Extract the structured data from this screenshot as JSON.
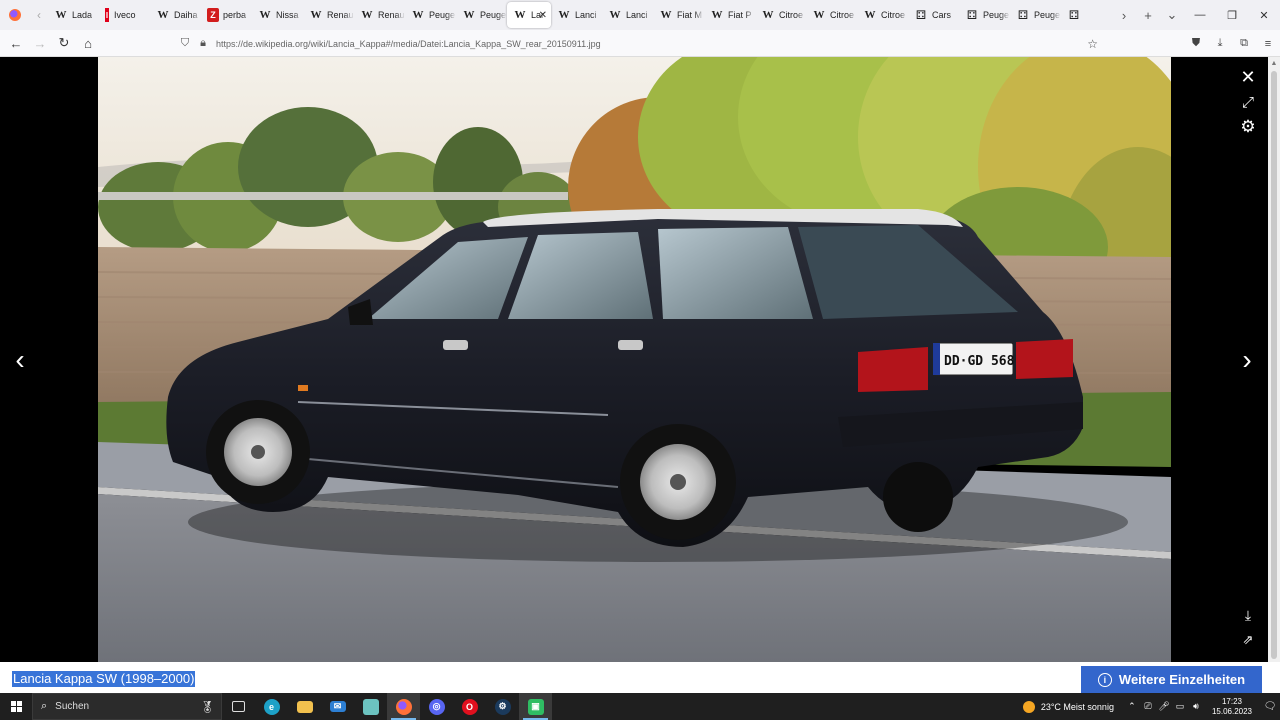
{
  "browser": {
    "tabs": [
      {
        "icon": "W",
        "label": "Lada",
        "favicon": "wikipedia-icon"
      },
      {
        "icon": "I",
        "label": "Iveco",
        "favicon": "iveco-icon"
      },
      {
        "icon": "W",
        "label": "Daiha",
        "favicon": "wikipedia-icon"
      },
      {
        "icon": "Z",
        "label": "perba",
        "favicon": "pdf-icon"
      },
      {
        "icon": "W",
        "label": "Nissa",
        "favicon": "wikipedia-icon"
      },
      {
        "icon": "W",
        "label": "Renau",
        "favicon": "wikipedia-icon"
      },
      {
        "icon": "W",
        "label": "Renau",
        "favicon": "wikipedia-icon"
      },
      {
        "icon": "W",
        "label": "Peuge",
        "favicon": "wikipedia-icon"
      },
      {
        "icon": "W",
        "label": "Peuge",
        "favicon": "wikipedia-icon"
      },
      {
        "icon": "W",
        "label": "Lar",
        "favicon": "wikipedia-icon",
        "active": true
      },
      {
        "icon": "W",
        "label": "Lanci",
        "favicon": "wikipedia-icon"
      },
      {
        "icon": "W",
        "label": "Lanci",
        "favicon": "wikipedia-icon"
      },
      {
        "icon": "W",
        "label": "Fiat M",
        "favicon": "wikipedia-icon"
      },
      {
        "icon": "W",
        "label": "Fiat P",
        "favicon": "wikipedia-icon"
      },
      {
        "icon": "W",
        "label": "Citroe",
        "favicon": "wikipedia-icon"
      },
      {
        "icon": "W",
        "label": "Citroe",
        "favicon": "wikipedia-icon"
      },
      {
        "icon": "W",
        "label": "Citroe",
        "favicon": "wikipedia-icon"
      },
      {
        "icon": "⚃",
        "label": "Cars",
        "favicon": "cars-icon"
      },
      {
        "icon": "⚃",
        "label": "Peuge",
        "favicon": "cars-icon"
      },
      {
        "icon": "⚃",
        "label": "Peuge",
        "favicon": "cars-icon"
      },
      {
        "icon": "⚃",
        "label": "",
        "favicon": "cars-icon"
      }
    ],
    "active_close": "✕",
    "url": "https://de.wikipedia.org/wiki/Lancia_Kappa#/media/Datei:Lancia_Kappa_SW_rear_20150911.jpg"
  },
  "viewer": {
    "caption": "Lancia Kappa SW (1998–2000)",
    "more_button": "Weitere Einzelheiten",
    "info_glyph": "i",
    "plate": "DD·GD 568"
  },
  "taskbar": {
    "search_label": "Suchen",
    "weather": "23°C  Meist sonnig",
    "time": "17:23",
    "date": "15.06.2023"
  },
  "colors": {
    "accent": "#3366cc",
    "selection": "#3874d8",
    "taskbar": "#1f1f1f"
  }
}
